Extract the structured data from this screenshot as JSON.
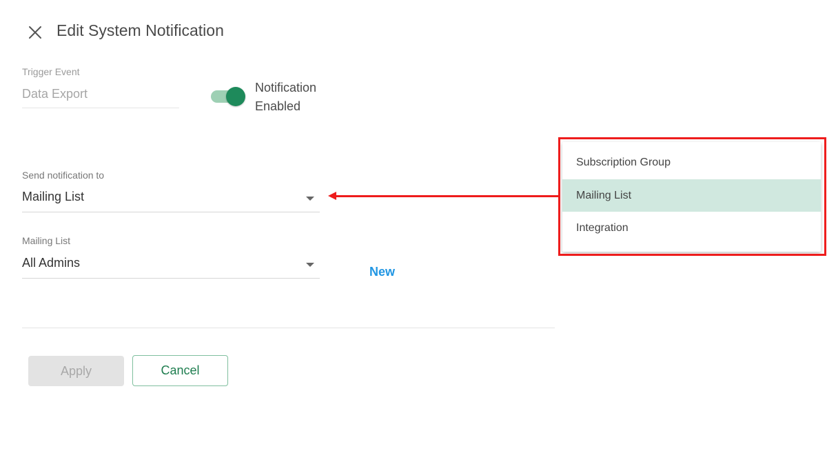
{
  "dialog": {
    "title": "Edit System Notification",
    "close_icon": "close-icon"
  },
  "trigger": {
    "label": "Trigger Event",
    "value": "Data Export"
  },
  "notification_toggle": {
    "label": "Notification Enabled",
    "enabled": true,
    "color_on": "#1e8a5b"
  },
  "send_to": {
    "label": "Send notification to",
    "value": "Mailing List"
  },
  "mailing_list": {
    "label": "Mailing List",
    "value": "All Admins",
    "new_label": "New"
  },
  "actions": {
    "apply_label": "Apply",
    "cancel_label": "Cancel"
  },
  "dropdown": {
    "options": [
      {
        "label": "Subscription Group",
        "selected": false
      },
      {
        "label": "Mailing List",
        "selected": true
      },
      {
        "label": "Integration",
        "selected": false
      }
    ],
    "highlight_color": "#d0e8df"
  },
  "annotation": {
    "callout_color": "#ee1c1c"
  }
}
